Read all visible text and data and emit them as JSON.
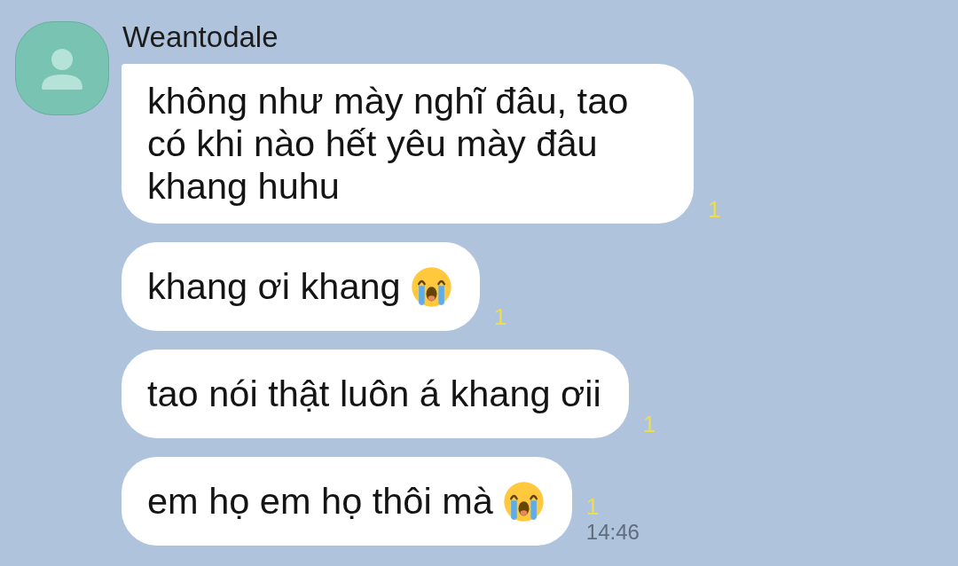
{
  "contact": {
    "name": "Weantodale"
  },
  "messages": [
    {
      "text": "không như mày nghĩ đâu, tao có khi nào hết yêu mày đâu khang huhu",
      "emoji": false,
      "read_count": "1"
    },
    {
      "text": "khang ơi khang",
      "emoji": true,
      "read_count": "1"
    },
    {
      "text": "tao nói thật luôn á khang ơii",
      "emoji": false,
      "read_count": "1"
    },
    {
      "text": "em họ em họ thôi mà",
      "emoji": true,
      "read_count": "1",
      "time": "14:46"
    }
  ]
}
